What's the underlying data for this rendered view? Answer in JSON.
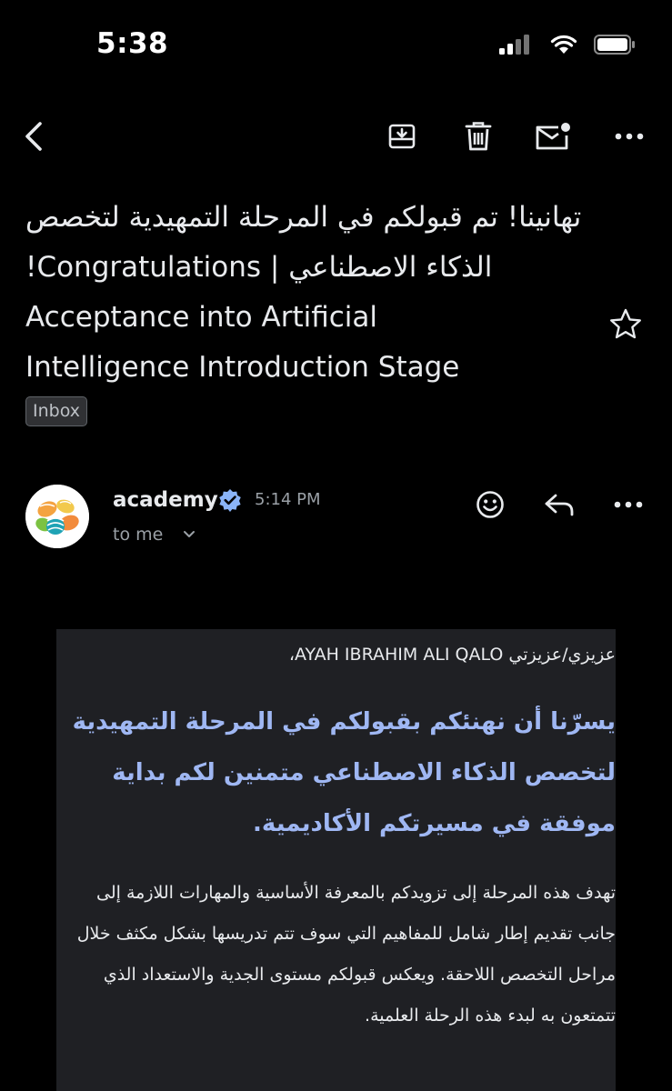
{
  "status_bar": {
    "time": "5:38"
  },
  "toolbar": {
    "back_icon": "chevron-left-icon",
    "archive_icon": "archive-icon",
    "delete_icon": "trash-icon",
    "unread_icon": "mail-unread-icon",
    "more_icon": "more-horizontal-icon"
  },
  "email": {
    "subject_arabic": "تهانينا! تم قبولكم في المرحلة التمهيدية لتخصص الذكاء الاصطناعي | Congratulations!",
    "subject_english_1": "Acceptance into Artificial",
    "subject_english_2": "Intelligence  Introduction Stage",
    "label": "Inbox",
    "starred": false
  },
  "sender": {
    "name": "academy",
    "verified": true,
    "time": "5:14 PM",
    "recipient": "to me"
  },
  "body": {
    "greeting": "عزيزي/عزيزتي AYAH IBRAHIM ALI QALO،",
    "highlight": "يسرّنا أن نهنئكم بقبولكم في المرحلة التمهيدية لتخصص الذكاء الاصطناعي متمنين لكم بداية موفقة في مسيرتكم الأكاديمية.",
    "paragraph": "تهدف هذه المرحلة إلى تزويدكم بالمعرفة الأساسية والمهارات اللازمة إلى جانب تقديم إطار شامل للمفاهيم التي سوف تتم تدريسها بشكل مكثف خلال مراحل التخصص اللاحقة. ويعكس قبولكم مستوى الجدية والاستعداد الذي تتمتعون به لبدء هذه الرحلة العلمية."
  },
  "colors": {
    "background": "#000000",
    "text": "#e8eaed",
    "secondary_text": "#9aa0a6",
    "highlight_text": "#9fb7f3",
    "verified_badge": "#8ab4f8",
    "card_background": "#1f2024"
  }
}
